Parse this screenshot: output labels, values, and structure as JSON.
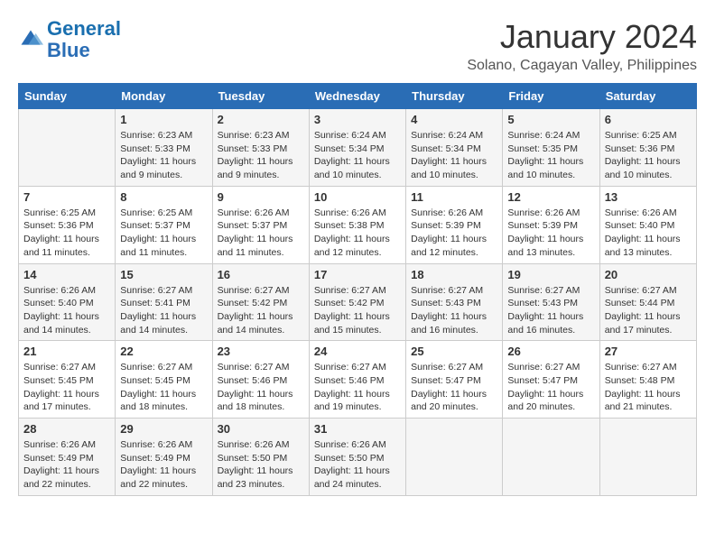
{
  "logo": {
    "text_general": "General",
    "text_blue": "Blue"
  },
  "title": "January 2024",
  "location": "Solano, Cagayan Valley, Philippines",
  "days_header": [
    "Sunday",
    "Monday",
    "Tuesday",
    "Wednesday",
    "Thursday",
    "Friday",
    "Saturday"
  ],
  "weeks": [
    [
      {
        "num": "",
        "info": ""
      },
      {
        "num": "1",
        "info": "Sunrise: 6:23 AM\nSunset: 5:33 PM\nDaylight: 11 hours\nand 9 minutes."
      },
      {
        "num": "2",
        "info": "Sunrise: 6:23 AM\nSunset: 5:33 PM\nDaylight: 11 hours\nand 9 minutes."
      },
      {
        "num": "3",
        "info": "Sunrise: 6:24 AM\nSunset: 5:34 PM\nDaylight: 11 hours\nand 10 minutes."
      },
      {
        "num": "4",
        "info": "Sunrise: 6:24 AM\nSunset: 5:34 PM\nDaylight: 11 hours\nand 10 minutes."
      },
      {
        "num": "5",
        "info": "Sunrise: 6:24 AM\nSunset: 5:35 PM\nDaylight: 11 hours\nand 10 minutes."
      },
      {
        "num": "6",
        "info": "Sunrise: 6:25 AM\nSunset: 5:36 PM\nDaylight: 11 hours\nand 10 minutes."
      }
    ],
    [
      {
        "num": "7",
        "info": "Sunrise: 6:25 AM\nSunset: 5:36 PM\nDaylight: 11 hours\nand 11 minutes."
      },
      {
        "num": "8",
        "info": "Sunrise: 6:25 AM\nSunset: 5:37 PM\nDaylight: 11 hours\nand 11 minutes."
      },
      {
        "num": "9",
        "info": "Sunrise: 6:26 AM\nSunset: 5:37 PM\nDaylight: 11 hours\nand 11 minutes."
      },
      {
        "num": "10",
        "info": "Sunrise: 6:26 AM\nSunset: 5:38 PM\nDaylight: 11 hours\nand 12 minutes."
      },
      {
        "num": "11",
        "info": "Sunrise: 6:26 AM\nSunset: 5:39 PM\nDaylight: 11 hours\nand 12 minutes."
      },
      {
        "num": "12",
        "info": "Sunrise: 6:26 AM\nSunset: 5:39 PM\nDaylight: 11 hours\nand 13 minutes."
      },
      {
        "num": "13",
        "info": "Sunrise: 6:26 AM\nSunset: 5:40 PM\nDaylight: 11 hours\nand 13 minutes."
      }
    ],
    [
      {
        "num": "14",
        "info": "Sunrise: 6:26 AM\nSunset: 5:40 PM\nDaylight: 11 hours\nand 14 minutes."
      },
      {
        "num": "15",
        "info": "Sunrise: 6:27 AM\nSunset: 5:41 PM\nDaylight: 11 hours\nand 14 minutes."
      },
      {
        "num": "16",
        "info": "Sunrise: 6:27 AM\nSunset: 5:42 PM\nDaylight: 11 hours\nand 14 minutes."
      },
      {
        "num": "17",
        "info": "Sunrise: 6:27 AM\nSunset: 5:42 PM\nDaylight: 11 hours\nand 15 minutes."
      },
      {
        "num": "18",
        "info": "Sunrise: 6:27 AM\nSunset: 5:43 PM\nDaylight: 11 hours\nand 16 minutes."
      },
      {
        "num": "19",
        "info": "Sunrise: 6:27 AM\nSunset: 5:43 PM\nDaylight: 11 hours\nand 16 minutes."
      },
      {
        "num": "20",
        "info": "Sunrise: 6:27 AM\nSunset: 5:44 PM\nDaylight: 11 hours\nand 17 minutes."
      }
    ],
    [
      {
        "num": "21",
        "info": "Sunrise: 6:27 AM\nSunset: 5:45 PM\nDaylight: 11 hours\nand 17 minutes."
      },
      {
        "num": "22",
        "info": "Sunrise: 6:27 AM\nSunset: 5:45 PM\nDaylight: 11 hours\nand 18 minutes."
      },
      {
        "num": "23",
        "info": "Sunrise: 6:27 AM\nSunset: 5:46 PM\nDaylight: 11 hours\nand 18 minutes."
      },
      {
        "num": "24",
        "info": "Sunrise: 6:27 AM\nSunset: 5:46 PM\nDaylight: 11 hours\nand 19 minutes."
      },
      {
        "num": "25",
        "info": "Sunrise: 6:27 AM\nSunset: 5:47 PM\nDaylight: 11 hours\nand 20 minutes."
      },
      {
        "num": "26",
        "info": "Sunrise: 6:27 AM\nSunset: 5:47 PM\nDaylight: 11 hours\nand 20 minutes."
      },
      {
        "num": "27",
        "info": "Sunrise: 6:27 AM\nSunset: 5:48 PM\nDaylight: 11 hours\nand 21 minutes."
      }
    ],
    [
      {
        "num": "28",
        "info": "Sunrise: 6:26 AM\nSunset: 5:49 PM\nDaylight: 11 hours\nand 22 minutes."
      },
      {
        "num": "29",
        "info": "Sunrise: 6:26 AM\nSunset: 5:49 PM\nDaylight: 11 hours\nand 22 minutes."
      },
      {
        "num": "30",
        "info": "Sunrise: 6:26 AM\nSunset: 5:50 PM\nDaylight: 11 hours\nand 23 minutes."
      },
      {
        "num": "31",
        "info": "Sunrise: 6:26 AM\nSunset: 5:50 PM\nDaylight: 11 hours\nand 24 minutes."
      },
      {
        "num": "",
        "info": ""
      },
      {
        "num": "",
        "info": ""
      },
      {
        "num": "",
        "info": ""
      }
    ]
  ]
}
